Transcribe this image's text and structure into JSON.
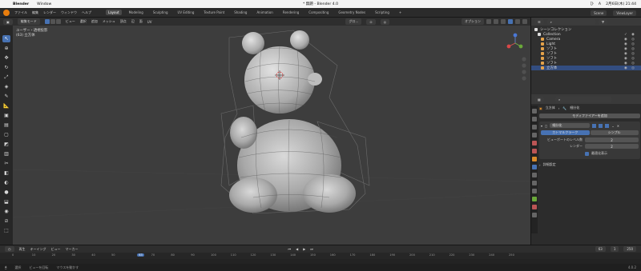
{
  "mac": {
    "apple": "",
    "app": "Blender",
    "menu": [
      "Window"
    ],
    "title": "* 無題 - Blender 4.0",
    "right": [
      "ひ",
      "A",
      "2月6日(木) 21:44"
    ]
  },
  "blender_menu": [
    "ファイル",
    "編集",
    "レンダー",
    "ウィンドウ",
    "ヘルプ"
  ],
  "workspaces": [
    "Layout",
    "Modeling",
    "Sculpting",
    "UV Editing",
    "Texture Paint",
    "Shading",
    "Animation",
    "Rendering",
    "Compositing",
    "Geometry Nodes",
    "Scripting",
    "+"
  ],
  "scene": "Scene",
  "view_layer": "ViewLayer",
  "viewport_header": {
    "mode": "編集モード",
    "menus": [
      "ビュー",
      "選択",
      "追加",
      "メッシュ",
      "頂点",
      "辺",
      "面",
      "UV"
    ],
    "orientation": "グロ...",
    "options": "オプション"
  },
  "viewport_info": {
    "line1": "ユーザー・透視投影",
    "line2": "(63) 立方体"
  },
  "outliner": {
    "root": "シーンコレクション",
    "rows": [
      {
        "name": "Collection",
        "indent": 1
      },
      {
        "name": "Camera",
        "indent": 2
      },
      {
        "name": "Light",
        "indent": 2
      },
      {
        "name": "ソフト",
        "indent": 2
      },
      {
        "name": "ソフト",
        "indent": 2
      },
      {
        "name": "ソフト",
        "indent": 2
      },
      {
        "name": "ソフト",
        "indent": 2
      },
      {
        "name": "立方体",
        "indent": 2
      }
    ]
  },
  "properties": {
    "breadcrumb_object": "立方体",
    "breadcrumb_modifier": "細分化",
    "add_modifier": "モディファイアーを追加",
    "modifier_name": "細分化",
    "tabs": [
      "カトマルクラーク",
      "シンプル"
    ],
    "fields": [
      {
        "label": "ビューポートのレベル数",
        "value": "2"
      },
      {
        "label": "レンダー",
        "value": "2"
      }
    ],
    "checkbox": "最適化表示",
    "advanced": "詳細設定"
  },
  "timeline": {
    "menus": [
      "再生",
      "キーイング",
      "ビュー",
      "マーカー"
    ],
    "current_frame": "63",
    "start": "1",
    "end": "250",
    "ticks": [
      "0",
      "10",
      "20",
      "30",
      "40",
      "50",
      "63",
      "70",
      "80",
      "90",
      "100",
      "110",
      "120",
      "130",
      "140",
      "150",
      "160",
      "170",
      "180",
      "190",
      "200",
      "210",
      "220",
      "230",
      "240",
      "250"
    ]
  },
  "status": {
    "left": "選択",
    "mid": "ビューを回転",
    "right": "マウスを動かす",
    "version": "4.0.2"
  },
  "colors": {
    "accent": "#4772b3",
    "orange": "#e87d0d",
    "header": "#2e2e2e",
    "viewport": "#3d3d3d"
  }
}
